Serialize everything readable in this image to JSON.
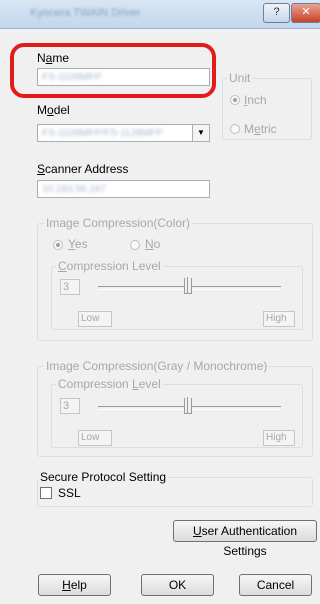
{
  "window": {
    "title": "Kyocera TWAIN Driver",
    "help_button": "?",
    "close_button": "✕"
  },
  "name": {
    "label_prefix": "N",
    "label_u": "a",
    "label_rest": "me",
    "value": "FS-1028MFP"
  },
  "model": {
    "label_prefix": "M",
    "label_u": "o",
    "label_rest": "del",
    "value": "FS-1028MFP/FS-1128MFP"
  },
  "unit": {
    "title": "Unit",
    "inch_label_u": "I",
    "inch_label_rest": "nch",
    "metric_label_prefix": "M",
    "metric_label_u": "e",
    "metric_label_rest": "tric"
  },
  "scanner_address": {
    "label_u": "S",
    "label_rest": "canner Address",
    "value": "10.183.56.167"
  },
  "image_compression_color": {
    "title": "Image Compression(Color)",
    "yes_label_u": "Y",
    "yes_label_rest": "es",
    "no_label_u": "N",
    "no_label_rest": "o",
    "level_title_u": "C",
    "level_title_rest": "ompression Level",
    "level_value": "3",
    "low": "Low",
    "high": "High"
  },
  "image_compression_gray": {
    "title": "Image Compression(Gray / Monochrome)",
    "level_title_prefix": "Compression ",
    "level_title_u": "L",
    "level_title_rest": "evel",
    "level_value": "3",
    "low": "Low",
    "high": "High"
  },
  "secure_protocol": {
    "title": "Secure Protocol Setting",
    "ssl_label": "SSL"
  },
  "buttons": {
    "user_auth_u": "U",
    "user_auth_rest": "ser Authentication Settings",
    "help_u": "H",
    "help_rest": "elp",
    "ok": "OK",
    "cancel": "Cancel"
  }
}
